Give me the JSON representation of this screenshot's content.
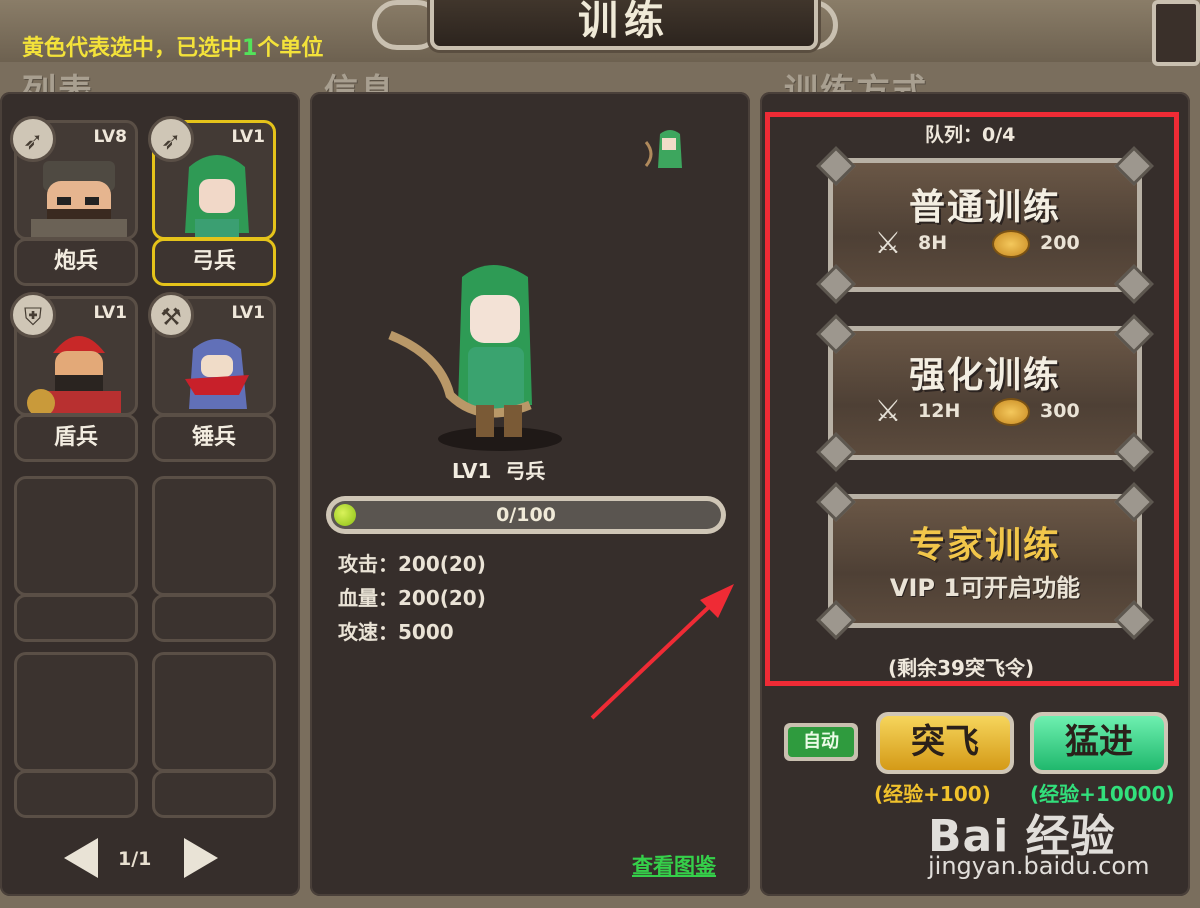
{
  "title": "训练",
  "hint": {
    "prefix": "黄色代表选中，已选中",
    "count": "1",
    "suffix": "个单位"
  },
  "sections": {
    "list": "列表",
    "info": "信息",
    "training": "训练方式"
  },
  "units": [
    {
      "name": "炮兵",
      "level": "LV8",
      "class_icon": "crossbow-icon",
      "selected": false
    },
    {
      "name": "弓兵",
      "level": "LV1",
      "class_icon": "crossbow-icon",
      "selected": true
    },
    {
      "name": "盾兵",
      "level": "LV1",
      "class_icon": "shield-icon",
      "selected": false
    },
    {
      "name": "锤兵",
      "level": "LV1",
      "class_icon": "hammer-icon",
      "selected": false
    }
  ],
  "pager": {
    "text": "1/1"
  },
  "info": {
    "unit_level": "LV1",
    "unit_name": "弓兵",
    "xp_text": "0/100",
    "xp_fraction": 0.0,
    "stats": [
      {
        "label": "攻击",
        "value": "200(20)"
      },
      {
        "label": "血量",
        "value": "200(20)"
      },
      {
        "label": "攻速",
        "value": "5000"
      }
    ],
    "link": "查看图鉴"
  },
  "training": {
    "queue": "队列：0/4",
    "options": [
      {
        "name": "普通训练",
        "time": "8H",
        "cost": "200"
      },
      {
        "name": "强化训练",
        "time": "12H",
        "cost": "300"
      },
      {
        "name": "专家训练",
        "sub": "VIP 1可开启功能"
      }
    ],
    "remaining": "(剩余39突飞令)",
    "auto_label": "自动",
    "tufei_label": "突飞",
    "tufei_exp": "(经验+100)",
    "mengjin_label": "猛进",
    "mengjin_exp": "(经验+10000)"
  },
  "watermark": {
    "main": "Bai 经验",
    "sub": "jingyan.baidu.com"
  },
  "colors": {
    "selected": "#e5c31a",
    "highlight_frame": "#ef2b35",
    "accent_green": "#53e35a"
  }
}
